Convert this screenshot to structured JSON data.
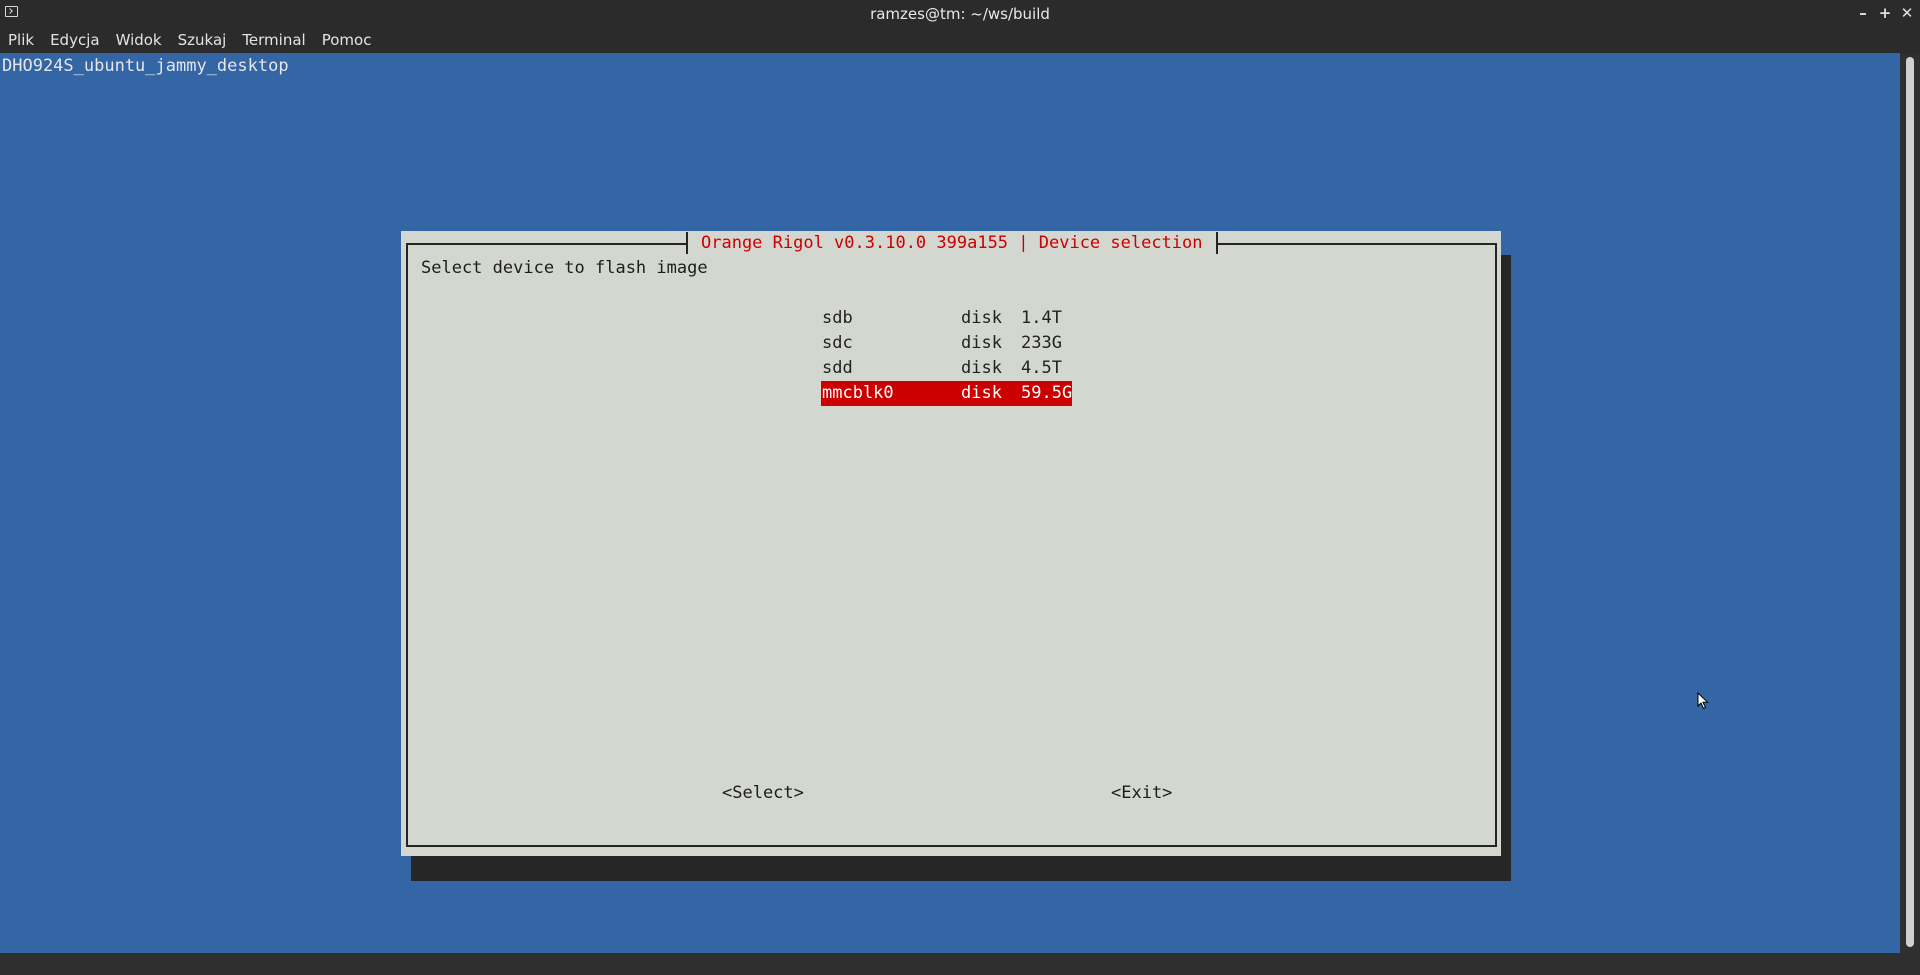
{
  "window": {
    "title": "ramzes@tm: ~/ws/build",
    "controls": {
      "minimize": "–",
      "maximize": "+",
      "close": "✕"
    }
  },
  "menu": [
    "Plik",
    "Edycja",
    "Widok",
    "Szukaj",
    "Terminal",
    "Pomoc"
  ],
  "terminal": {
    "host_line": "DHO924S_ubuntu_jammy_desktop"
  },
  "dialog": {
    "title": "Orange Rigol v0.3.10.0 399a155 | Device selection",
    "prompt": "Select device to flash image",
    "devices": [
      {
        "name": "sdb",
        "type": "disk",
        "size": "1.4T"
      },
      {
        "name": "sdc",
        "type": "disk",
        "size": "233G"
      },
      {
        "name": "sdd",
        "type": "disk",
        "size": "4.5T"
      },
      {
        "name": "mmcblk0",
        "type": "disk",
        "size": "59.5G"
      }
    ],
    "selected_index": 3,
    "buttons": {
      "select": "<Select>",
      "exit": "<Exit>"
    }
  },
  "colors": {
    "terminal_bg": "#3465a4",
    "dialog_bg": "#d3d7cf",
    "accent": "#cc0000",
    "chrome": "#2b2b2b"
  },
  "icons": {
    "app": "terminal-icon",
    "cursor": "mouse-pointer-icon"
  }
}
